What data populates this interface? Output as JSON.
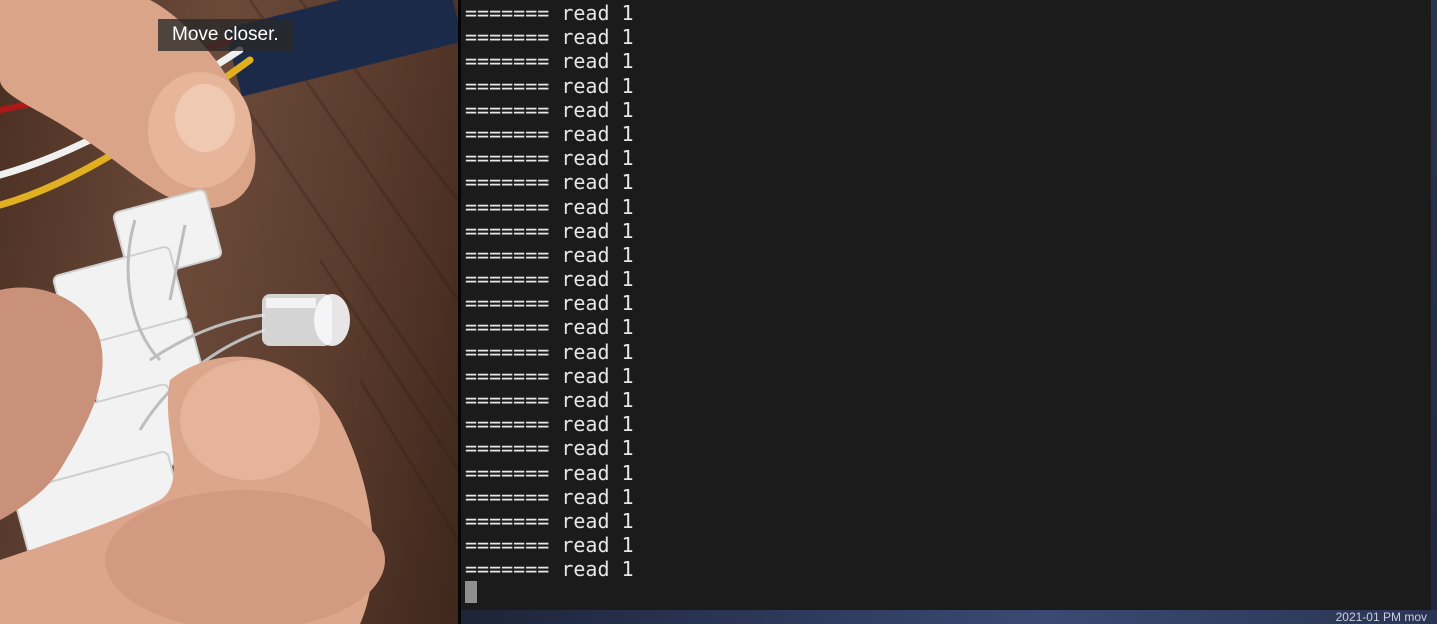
{
  "camera": {
    "caption": "Move closer."
  },
  "terminal": {
    "lines": [
      "======= read 1",
      "======= read 1",
      "======= read 1",
      "======= read 1",
      "======= read 1",
      "======= read 1",
      "======= read 1",
      "======= read 1",
      "======= read 1",
      "======= read 1",
      "======= read 1",
      "======= read 1",
      "======= read 1",
      "======= read 1",
      "======= read 1",
      "======= read 1",
      "======= read 1",
      "======= read 1",
      "======= read 1",
      "======= read 1",
      "======= read 1",
      "======= read 1",
      "======= read 1",
      "======= read 1"
    ]
  },
  "desktop": {
    "clock_text": "2021-01 PM mov"
  },
  "colors": {
    "terminal_bg": "#1b1b1b",
    "terminal_fg": "#e6e6e6",
    "cursor": "#8f8f8f"
  }
}
